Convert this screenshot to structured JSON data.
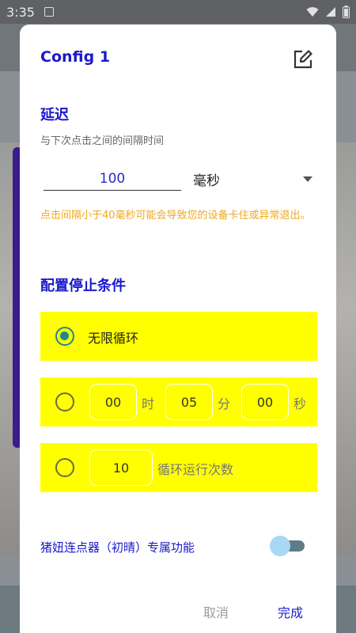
{
  "status_bar": {
    "time": "3:35"
  },
  "dialog": {
    "title": "Config 1",
    "delay": {
      "section_title": "延迟",
      "subtitle": "与下次点击之间的间隔时间",
      "value": "100",
      "unit": "毫秒",
      "warning": "点击间隔小于40毫秒可能会导致您的设备卡住或异常退出。"
    },
    "stop_condition": {
      "section_title": "配置停止条件",
      "infinite_label": "无限循环",
      "time": {
        "hours": "00",
        "hours_unit": "时",
        "minutes": "05",
        "minutes_unit": "分",
        "seconds": "00",
        "seconds_unit": "秒"
      },
      "count": {
        "value": "10",
        "label": "循环运行次数"
      },
      "selected": "infinite"
    },
    "feature": {
      "label": "猪妞连点器（初晴）专属功能",
      "enabled": false
    },
    "buttons": {
      "cancel": "取消",
      "done": "完成"
    }
  },
  "colors": {
    "accent": "#1a1acc",
    "option_bg": "#ffff00",
    "warning": "#f0a81e",
    "radio_checked": "#1b8a86"
  }
}
